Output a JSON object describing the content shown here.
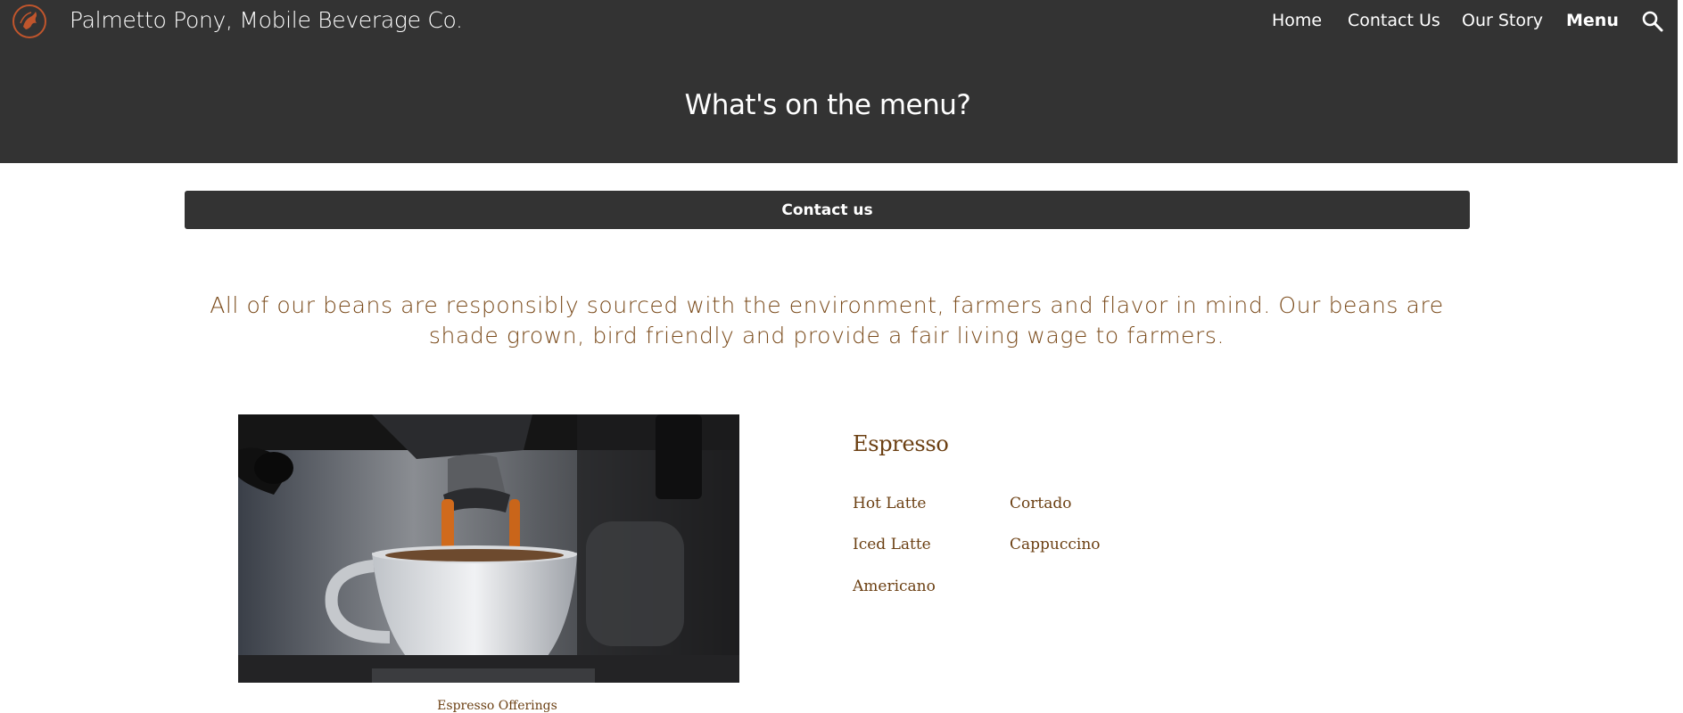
{
  "header": {
    "site_title": "Palmetto Pony, Mobile Beverage Co.",
    "page_title": "What's on the menu?",
    "nav": [
      {
        "label": "Home"
      },
      {
        "label": "Contact Us"
      },
      {
        "label": "Our Story"
      },
      {
        "label": "Menu",
        "active": true
      }
    ]
  },
  "contact_button": {
    "label": "Contact us"
  },
  "intro": {
    "text": "All of our beans are responsibly sourced with the environment, farmers and flavor in mind. Our beans are shade grown, bird friendly and provide a fair living wage to farmers."
  },
  "image": {
    "caption": "Espresso Offerings"
  },
  "espresso": {
    "heading": "Espresso",
    "items": [
      "Hot Latte",
      "Cortado",
      "Iced Latte",
      "Cappuccino",
      "Americano"
    ]
  },
  "colors": {
    "header_bg": "#333333",
    "accent_text": "#6b3f12",
    "logo": "#c0552c"
  }
}
